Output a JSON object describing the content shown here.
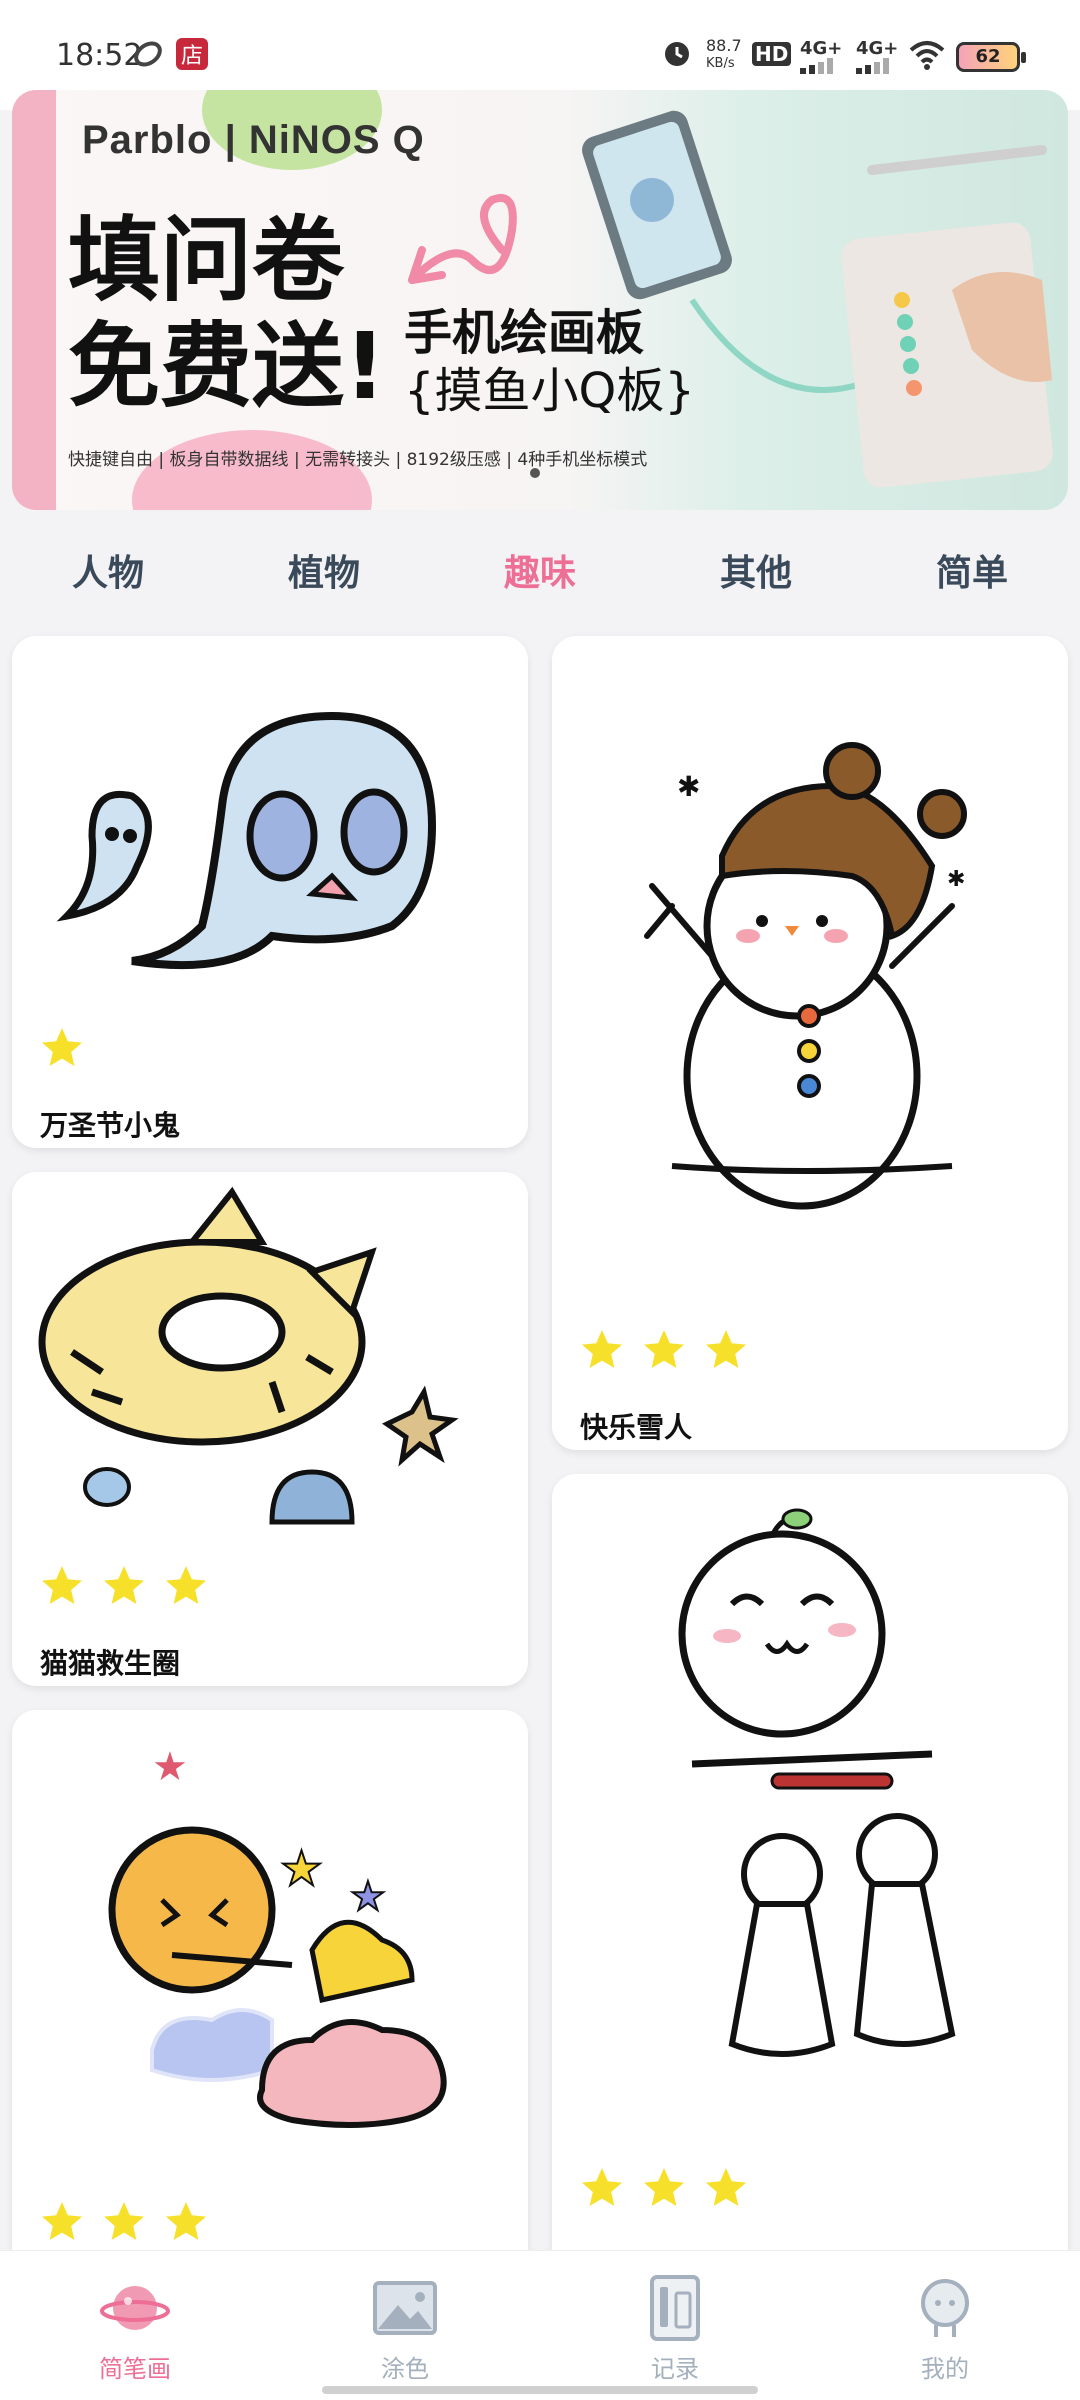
{
  "status_bar": {
    "time": "18:52",
    "network_speed_value": "88.7",
    "network_speed_unit": "KB/s",
    "hd_label": "HD",
    "signal1": "4G+",
    "signal2": "4G+",
    "battery": "62"
  },
  "banner": {
    "brand": "Parblo | NiNOS Q",
    "headline_line1": "填问卷",
    "headline_line2": "免费送!",
    "subhead_line1": "手机绘画板",
    "subhead_line2": "{摸鱼小Q板}",
    "features": "快捷键自由 | 板身自带数据线 | 无需转接头 | 8192级压感 | 4种手机坐标模式"
  },
  "tabs": [
    {
      "label": "人物",
      "active": false
    },
    {
      "label": "植物",
      "active": false
    },
    {
      "label": "趣味",
      "active": true
    },
    {
      "label": "其他",
      "active": false
    },
    {
      "label": "简单",
      "active": false
    }
  ],
  "cards": {
    "ghost": {
      "title": "万圣节小鬼",
      "stars": 1
    },
    "snowman": {
      "title": "快乐雪人",
      "stars": 3
    },
    "cat_ring": {
      "title": "猫猫救生圈",
      "stars": 3
    },
    "sun_cloud": {
      "title": "",
      "stars": 3
    },
    "teru_bozu": {
      "title": "",
      "stars": 3
    }
  },
  "bottom_nav": [
    {
      "label": "简笔画",
      "icon": "planet-icon",
      "active": true
    },
    {
      "label": "涂色",
      "icon": "image-icon",
      "active": false
    },
    {
      "label": "记录",
      "icon": "notebook-icon",
      "active": false
    },
    {
      "label": "我的",
      "icon": "profile-icon",
      "active": false
    }
  ],
  "colors": {
    "accent": "#ee6f95",
    "star": "#f7e02a",
    "nav_inactive": "#a4b0bd"
  }
}
